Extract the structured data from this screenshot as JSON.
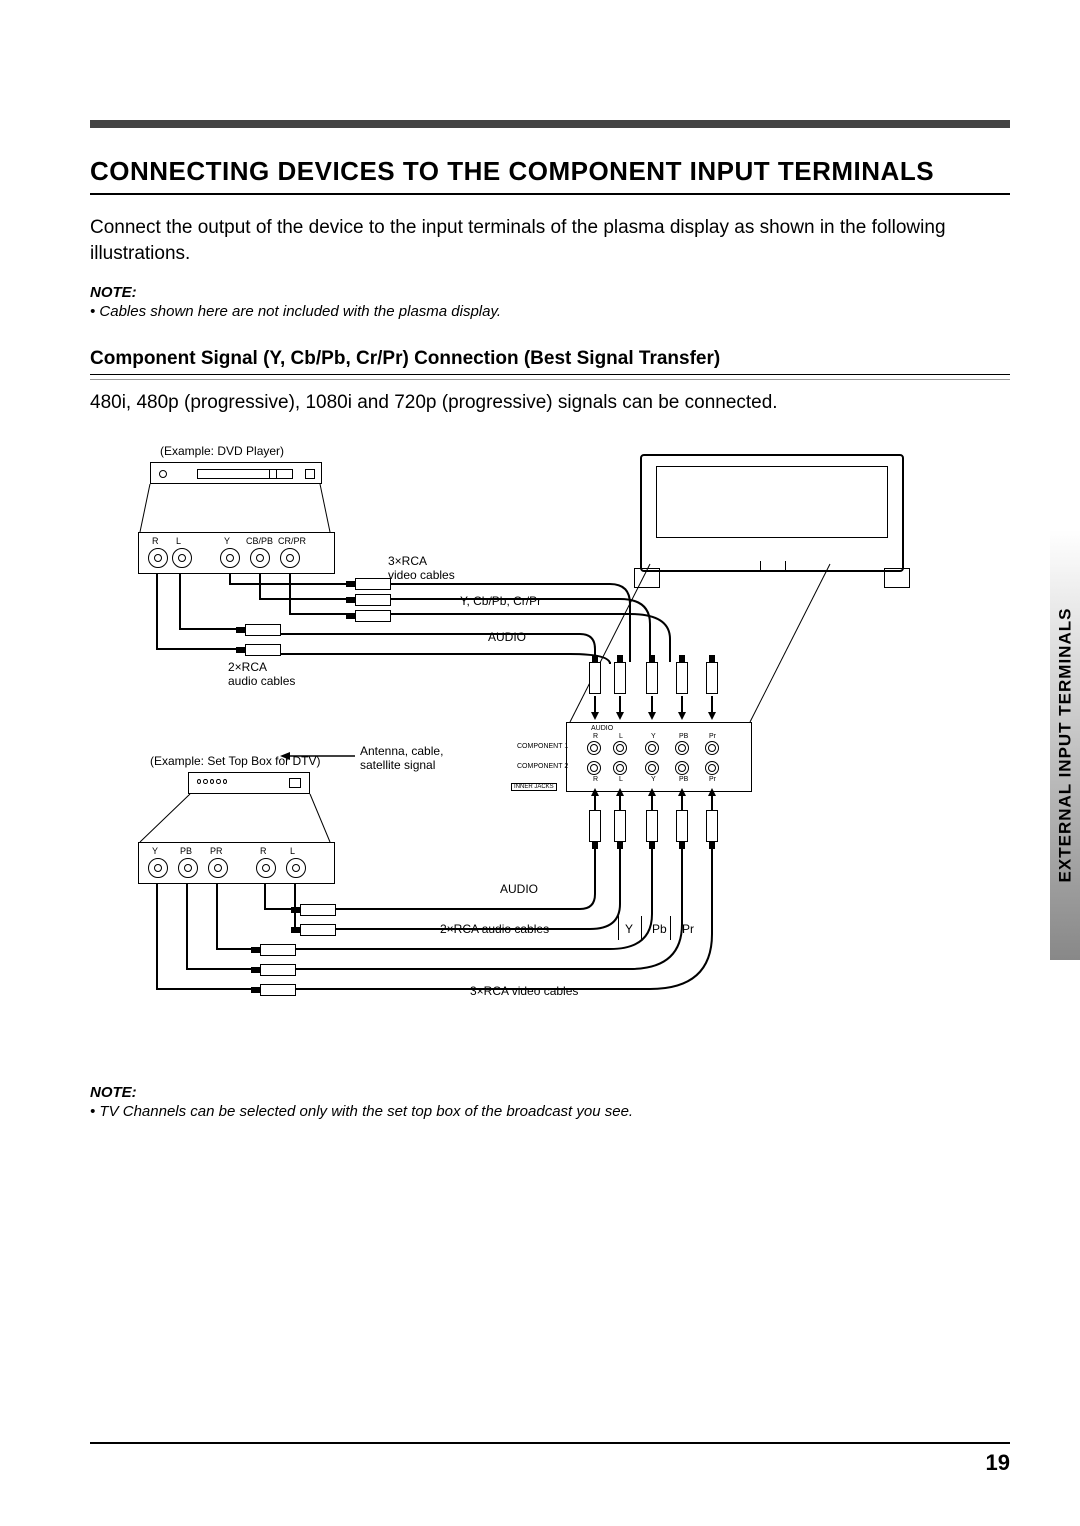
{
  "header": {
    "title": "CONNECTING DEVICES TO THE COMPONENT INPUT TERMINALS"
  },
  "intro": "Connect the output of the device to the input terminals of the plasma display as shown in the following illustrations.",
  "note1": {
    "head": "NOTE:",
    "bullet": "• Cables shown here are not included with the plasma display."
  },
  "section": {
    "title": "Component Signal (Y, Cb/Pb, Cr/Pr) Connection (Best Signal Transfer)",
    "body": "480i, 480p (progressive), 1080i and 720p (progressive) signals can be connected."
  },
  "diagram": {
    "dvd_caption": "(Example: DVD Player)",
    "dvd_jacks": {
      "r": "R",
      "l": "L",
      "y": "Y",
      "cbpb": "CB/PB",
      "crpr": "CR/PR"
    },
    "video3": "3×RCA\nvideo cables",
    "ypbpr": "Y, Cb/Pb, Cr/Pr",
    "audio": "AUDIO",
    "audio2": "2×RCA\naudio cables",
    "stb_caption": "(Example: Set Top Box for DTV)",
    "antenna": "Antenna, cable,\nsatellite signal",
    "stb_jacks": {
      "y": "Y",
      "pb": "PB",
      "pr": "PR",
      "r": "R",
      "l": "L"
    },
    "audio2b": "2×RCA audio cables",
    "video3b": "3×RCA video cables",
    "y": "Y",
    "pb": "Pb",
    "pr": "Pr",
    "panel": {
      "audio_header": "AUDIO",
      "r": "R",
      "l": "L",
      "y": "Y",
      "pb": "PB",
      "pr": "Pr",
      "c1": "COMPONENT 1",
      "c2": "COMPONENT 2",
      "inner": "INNER JACKS"
    }
  },
  "note2": {
    "head": "NOTE:",
    "bullet": "• TV Channels can be selected only with the set top box of the broadcast you see."
  },
  "side_tab": "EXTERNAL INPUT TERMINALS",
  "page_number": "19"
}
